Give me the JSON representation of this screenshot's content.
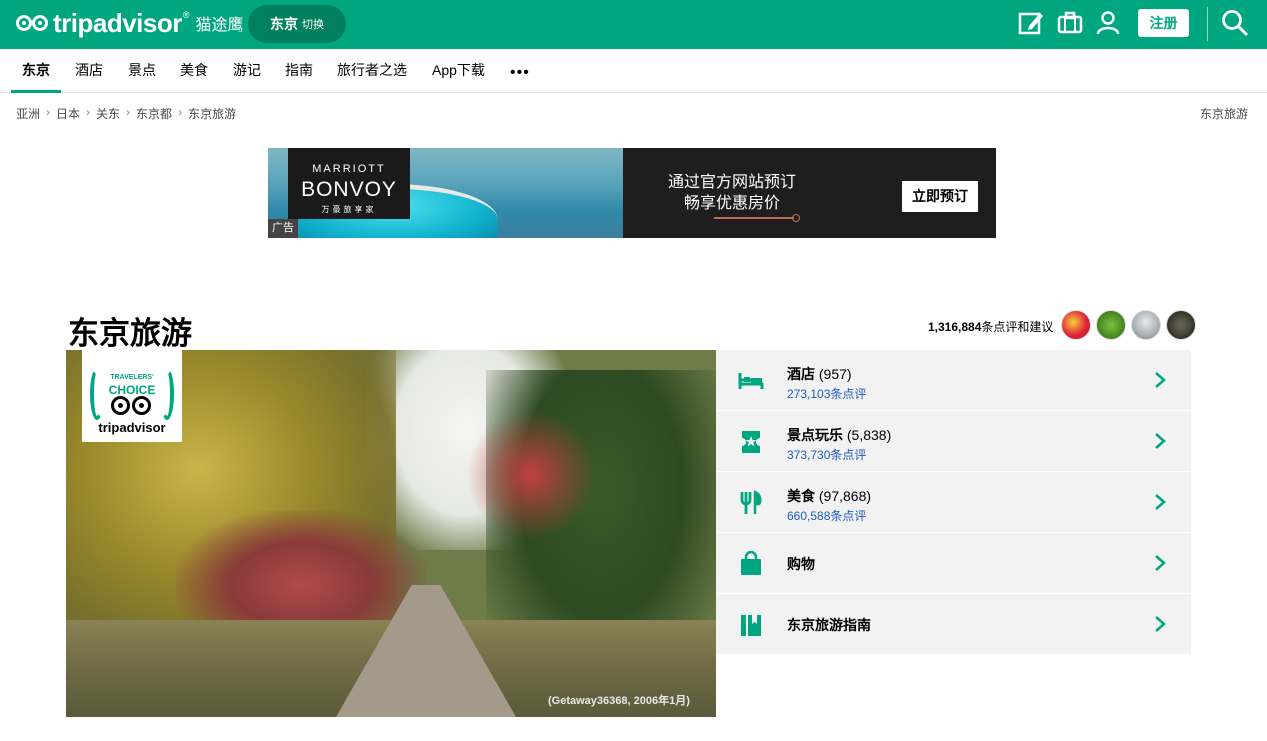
{
  "header": {
    "brand": "tripadvisor",
    "brand_reg": "®",
    "brand_cn": "猫途鹰",
    "city_pill": {
      "city": "东京",
      "switch": "切换"
    },
    "register": "注册",
    "icons": [
      "edit-icon",
      "trips-icon",
      "profile-icon",
      "search-icon"
    ],
    "accent_color": "#00a680"
  },
  "nav": {
    "items": [
      {
        "label": "东京",
        "active": true
      },
      {
        "label": "酒店"
      },
      {
        "label": "景点"
      },
      {
        "label": "美食"
      },
      {
        "label": "游记"
      },
      {
        "label": "指南"
      },
      {
        "label": "旅行者之选"
      },
      {
        "label": "App下载"
      }
    ],
    "more": "•••"
  },
  "breadcrumb": {
    "items": [
      "亚洲",
      "日本",
      "关东",
      "东京都",
      "东京旅游"
    ],
    "separator": "›",
    "right": "东京旅游"
  },
  "ad": {
    "logo_top": "MARRIOTT",
    "logo_main": "BONVOY",
    "logo_sub": "万豪旅享家",
    "tag": "广告",
    "line1": "通过官方网站预订",
    "line2": "畅享优惠房价",
    "button": "立即预订"
  },
  "main": {
    "title": "东京旅游",
    "review_count": "1,316,884",
    "review_suffix": "条点评和建议",
    "badge": {
      "top": "TRAVELERS'",
      "main": "CHOICE",
      "brand": "tripadvisor"
    },
    "photo_credit": "(Getaway36368, 2006年1月)"
  },
  "categories": [
    {
      "name": "酒店",
      "count": "(957)",
      "reviews": "273,103条点评",
      "icon": "bed-icon"
    },
    {
      "name": "景点玩乐",
      "count": "(5,838)",
      "reviews": "373,730条点评",
      "icon": "ticket-icon"
    },
    {
      "name": "美食",
      "count": "(97,868)",
      "reviews": "660,588条点评",
      "icon": "fork-knife-icon"
    },
    {
      "name": "购物",
      "count": "",
      "reviews": "",
      "icon": "shopping-bag-icon"
    },
    {
      "name": "东京旅游指南",
      "count": "",
      "reviews": "",
      "icon": "guide-book-icon"
    }
  ]
}
